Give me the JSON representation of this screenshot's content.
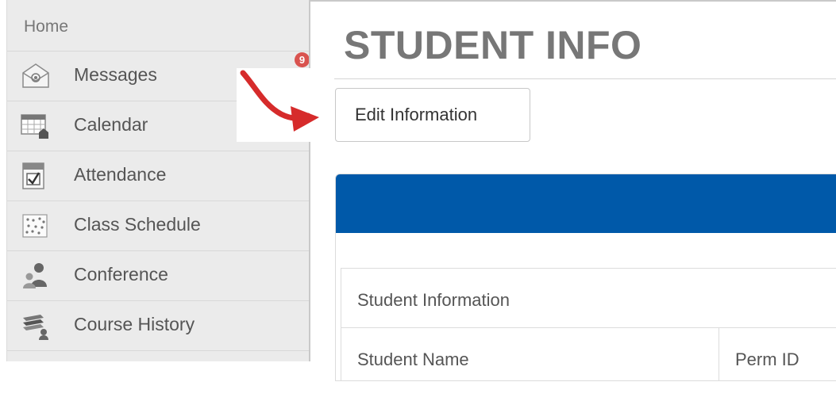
{
  "sidebar": {
    "home_label": "Home",
    "items": [
      {
        "label": "Messages",
        "icon": "envelope-icon",
        "badge": "9"
      },
      {
        "label": "Calendar",
        "icon": "calendar-icon"
      },
      {
        "label": "Attendance",
        "icon": "attendance-checklist-icon"
      },
      {
        "label": "Class Schedule",
        "icon": "schedule-grid-icon"
      },
      {
        "label": "Conference",
        "icon": "people-icon"
      },
      {
        "label": "Course History",
        "icon": "books-icon"
      }
    ]
  },
  "main": {
    "title": "STUDENT INFO",
    "edit_button_label": "Edit Information",
    "section_label": "Student Information",
    "columns": [
      "Student Name",
      "Perm ID"
    ]
  },
  "colors": {
    "panel_header": "#0059a9",
    "badge": "#d9534f",
    "annotation_arrow": "#d62b2b",
    "sidebar_bg": "#ebebeb"
  }
}
